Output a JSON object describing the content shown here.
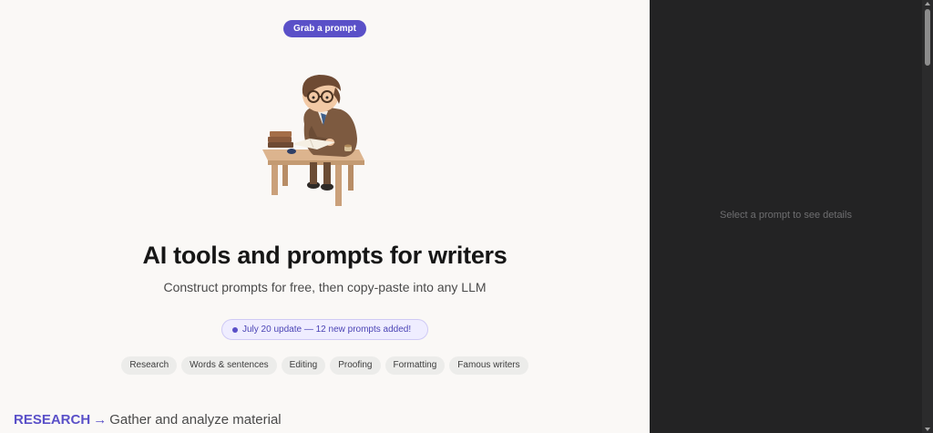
{
  "header": {
    "cta_label": "Grab a prompt"
  },
  "hero": {
    "title": "AI tools and prompts for writers",
    "subtitle": "Construct prompts for free, then copy-paste into any LLM",
    "update": "July 20 update — 12 new prompts added!"
  },
  "categories": [
    {
      "label": "Research"
    },
    {
      "label": "Words & sentences"
    },
    {
      "label": "Editing"
    },
    {
      "label": "Proofing"
    },
    {
      "label": "Formatting"
    },
    {
      "label": "Famous writers"
    }
  ],
  "section": {
    "title": "RESEARCH",
    "arrow": "→",
    "description": "Gather and analyze material"
  },
  "details_panel": {
    "placeholder": "Select a prompt to see details"
  },
  "colors": {
    "accent": "#5a50c8",
    "dark_panel": "#232324",
    "page_bg": "#faf8f6"
  }
}
